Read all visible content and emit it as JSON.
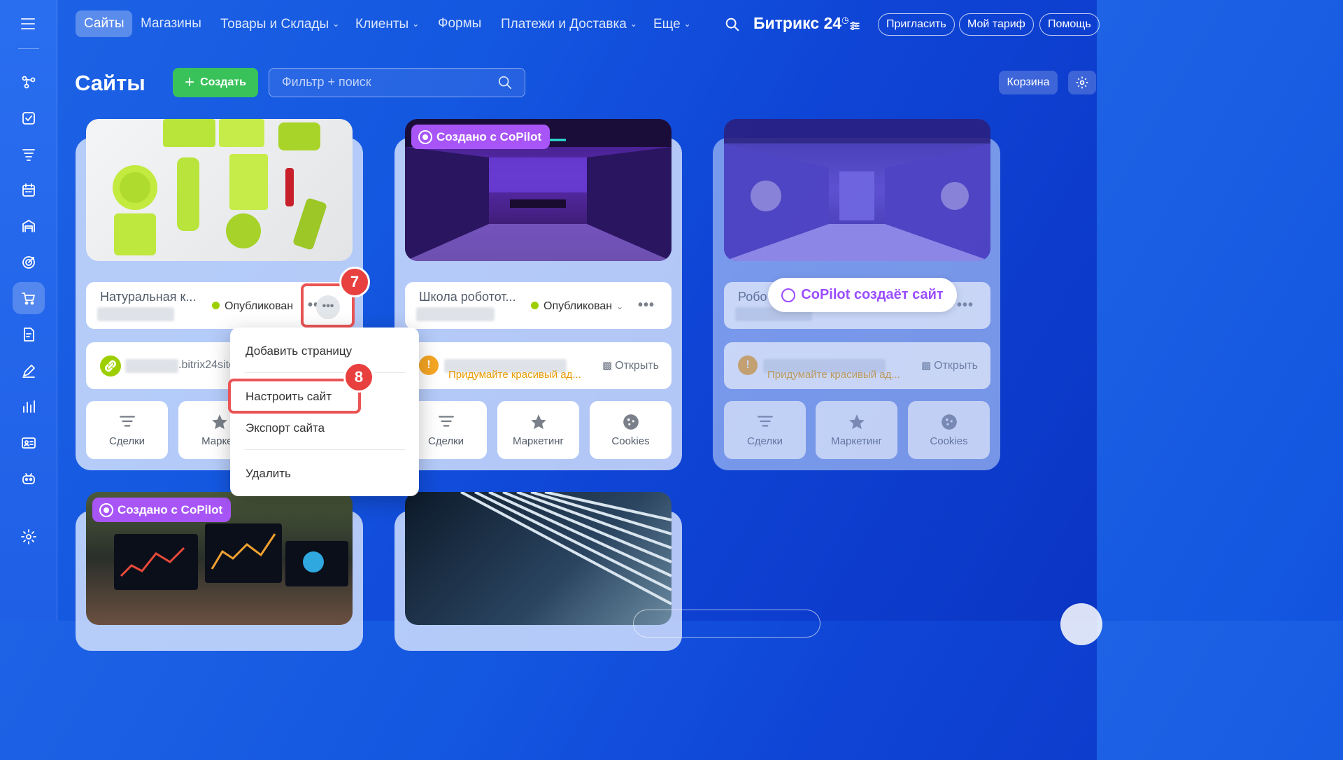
{
  "topnav": {
    "items": [
      {
        "label": "Сайты",
        "active": true
      },
      {
        "label": "Магазины"
      },
      {
        "label": "Товары и Склады",
        "dropdown": true
      },
      {
        "label": "Клиенты",
        "dropdown": true
      },
      {
        "label": "Формы"
      },
      {
        "label": "Платежи и Доставка",
        "dropdown": true
      },
      {
        "label": "Еще",
        "dropdown": true
      }
    ],
    "brand": "Битрикс 24",
    "invite": "Пригласить",
    "tariff": "Мой тариф",
    "help": "Помощь"
  },
  "header": {
    "title": "Сайты",
    "create": "Создать",
    "filter_placeholder": "Фильтр + поиск",
    "trash": "Корзина"
  },
  "sidebar_icons": [
    "menu-icon",
    "feed-icon",
    "tasks-icon",
    "crm-icon",
    "calendar-icon",
    "warehouse-icon",
    "target-icon",
    "shop-icon",
    "document-icon",
    "sign-icon",
    "analytics-icon",
    "contact-center-icon",
    "robot-icon",
    "settings-icon"
  ],
  "cards": [
    {
      "name": "Натуральная к...",
      "status": "Опубликован",
      "url_suffix": ".bitrix24site",
      "tiles": [
        "Сделки",
        "Маркет"
      ]
    },
    {
      "badge": "Создано с CoPilot",
      "name": "Школа роботот...",
      "status": "Опубликован",
      "warning": "Придумайте красивый ад...",
      "open": "Открыть",
      "tiles": [
        "Сделки",
        "Маркетинг",
        "Cookies"
      ]
    },
    {
      "name": "Робо",
      "creating": "CoPilot создаёт сайт",
      "warning": "Придумайте красивый ад...",
      "open": "Открыть",
      "tiles": [
        "Сделки",
        "Маркетинг",
        "Cookies"
      ]
    },
    {
      "badge": "Создано с CoPilot"
    }
  ],
  "menu": {
    "items": [
      "Добавить страницу",
      "Настроить сайт",
      "Экспорт сайта",
      "Удалить"
    ]
  },
  "steps": {
    "dots": "7",
    "settings": "8"
  },
  "colors": {
    "accent_green": "#3ac25a",
    "copilot_purple": "#a855f7",
    "highlight_red": "#ea5455",
    "published_dot": "#9dcf00",
    "warning": "#e89b00"
  }
}
